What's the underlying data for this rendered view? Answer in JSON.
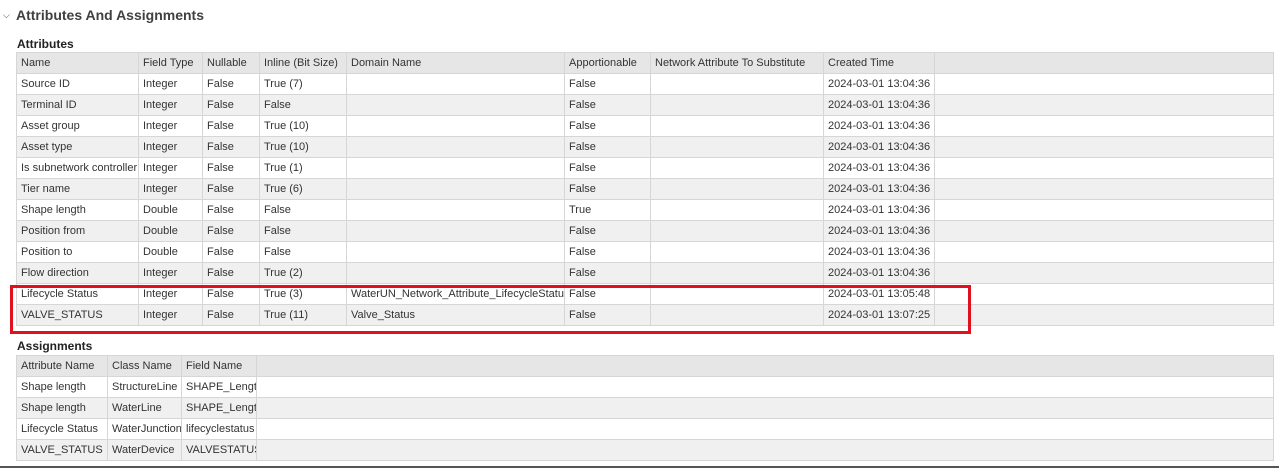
{
  "section": {
    "title": "Attributes And Assignments",
    "chevron_icon": "chevron-down-icon"
  },
  "attributes": {
    "title": "Attributes",
    "columns": [
      "Name",
      "Field Type",
      "Nullable",
      "Inline (Bit Size)",
      "Domain Name",
      "Apportionable",
      "Network Attribute To Substitute",
      "Created Time"
    ],
    "rows": [
      [
        "Source ID",
        "Integer",
        "False",
        "True (7)",
        "",
        "False",
        "",
        "2024-03-01 13:04:36"
      ],
      [
        "Terminal ID",
        "Integer",
        "False",
        "False",
        "",
        "False",
        "",
        "2024-03-01 13:04:36"
      ],
      [
        "Asset group",
        "Integer",
        "False",
        "True (10)",
        "",
        "False",
        "",
        "2024-03-01 13:04:36"
      ],
      [
        "Asset type",
        "Integer",
        "False",
        "True (10)",
        "",
        "False",
        "",
        "2024-03-01 13:04:36"
      ],
      [
        "Is subnetwork controller",
        "Integer",
        "False",
        "True (1)",
        "",
        "False",
        "",
        "2024-03-01 13:04:36"
      ],
      [
        "Tier name",
        "Integer",
        "False",
        "True (6)",
        "",
        "False",
        "",
        "2024-03-01 13:04:36"
      ],
      [
        "Shape length",
        "Double",
        "False",
        "False",
        "",
        "True",
        "",
        "2024-03-01 13:04:36"
      ],
      [
        "Position from",
        "Double",
        "False",
        "False",
        "",
        "False",
        "",
        "2024-03-01 13:04:36"
      ],
      [
        "Position to",
        "Double",
        "False",
        "False",
        "",
        "False",
        "",
        "2024-03-01 13:04:36"
      ],
      [
        "Flow direction",
        "Integer",
        "False",
        "True (2)",
        "",
        "False",
        "",
        "2024-03-01 13:04:36"
      ],
      [
        "Lifecycle Status",
        "Integer",
        "False",
        "True (3)",
        "WaterUN_Network_Attribute_LifecycleStatus",
        "False",
        "",
        "2024-03-01 13:05:48"
      ],
      [
        "VALVE_STATUS",
        "Integer",
        "False",
        "True (11)",
        "Valve_Status",
        "False",
        "",
        "2024-03-01 13:07:25"
      ]
    ]
  },
  "assignments": {
    "title": "Assignments",
    "columns": [
      "Attribute Name",
      "Class Name",
      "Field Name"
    ],
    "rows": [
      [
        "Shape length",
        "StructureLine",
        "SHAPE_Length"
      ],
      [
        "Shape length",
        "WaterLine",
        "SHAPE_Length"
      ],
      [
        "Lifecycle Status",
        "WaterJunction",
        "lifecyclestatus"
      ],
      [
        "VALVE_STATUS",
        "WaterDevice",
        "VALVESTATUS"
      ]
    ]
  },
  "highlight_color": "#e0101e"
}
